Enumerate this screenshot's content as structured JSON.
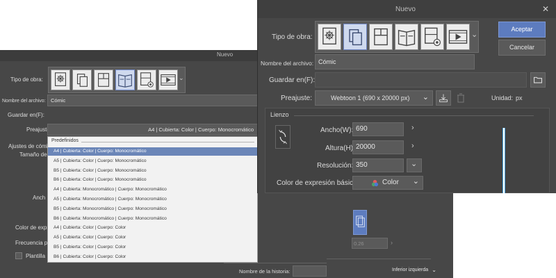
{
  "back": {
    "title": "Nuevo",
    "work_type_label": "Tipo de obra:",
    "filename_label": "Nombre del archivo:",
    "filename_value": "Cómic",
    "save_in_label": "Guardar en(F):",
    "preset_label": "Preajuste:",
    "preset_value": "A4 | Cubierta: Color | Cuerpo: Monocromático",
    "truncated_labels": {
      "settings": "Ajustes de cómi",
      "size": "Tamaño de",
      "width": "Anch",
      "color": "Color de expr",
      "frequency": "Frecuencia pr",
      "template": "Plantilla",
      "resolution_value": "0.26",
      "story_name": "Nombre de la historia:",
      "position": "Inferior izquierda"
    },
    "dropdown": {
      "header": "Predefinidos",
      "items": [
        "A4 | Cubierta: Color | Cuerpo: Monocromático",
        "A5 | Cubierta: Color | Cuerpo: Monocromático",
        "B5 | Cubierta: Color | Cuerpo: Monocromático",
        "B6 | Cubierta: Color | Cuerpo: Monocromático",
        "A4 | Cubierta: Monocromático | Cuerpo: Monocromático",
        "A5 | Cubierta: Monocromático | Cuerpo: Monocromático",
        "B5 | Cubierta: Monocromático | Cuerpo: Monocromático",
        "B6 | Cubierta: Monocromático | Cuerpo: Monocromático",
        "A4 | Cubierta: Color | Cuerpo: Color",
        "A5 | Cubierta: Color | Cuerpo: Color",
        "B5 | Cubierta: Color | Cuerpo: Color",
        "B6 | Cubierta: Color | Cuerpo: Color"
      ],
      "selected_index": 0
    }
  },
  "front": {
    "title": "Nuevo",
    "close_glyph": "✕",
    "work_type_label": "Tipo de obra:",
    "filename_label": "Nombre del archivo:",
    "filename_value": "Cómic",
    "save_in_label": "Guardar en(F):",
    "preset_label": "Preajuste:",
    "preset_value": "Webtoon 1 (690 x 20000 px)",
    "unit_label": "Unidad:",
    "unit_value": "px",
    "accept_label": "Aceptar",
    "cancel_label": "Cancelar",
    "canvas_section": "Lienzo",
    "width_label": "Ancho(W):",
    "width_value": "690",
    "height_label": "Altura(H):",
    "height_value": "20000",
    "resolution_label": "Resolución:",
    "resolution_value": "350",
    "color_label": "Color de expresión básico:",
    "color_value": "Color"
  },
  "colors": {
    "dialog_bg": "#474747",
    "titlebar_bg": "#3c3c3c",
    "field_bg": "#5a5a5a",
    "accent": "#5d7cbf",
    "highlight": "#6b86b8",
    "preview_line": "#4aa8e8"
  }
}
